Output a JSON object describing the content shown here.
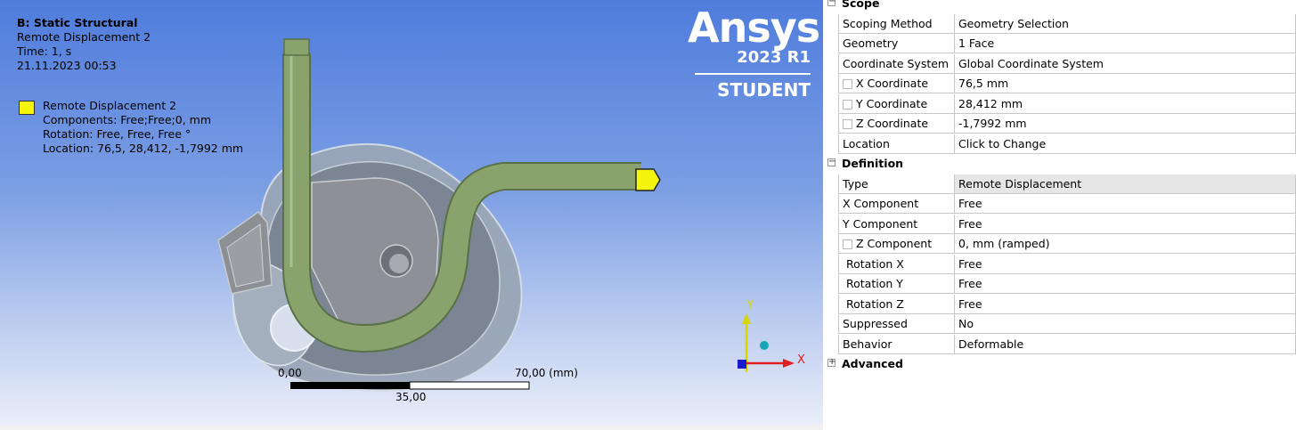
{
  "viewport": {
    "analysis_title": "B: Static Structural",
    "object_name": "Remote Displacement 2",
    "time": "Time: 1, s",
    "date": "21.11.2023 00:53",
    "legend": {
      "color": "#f4f40c",
      "name": "Remote Displacement 2",
      "components": "Components: Free;Free;0, mm",
      "rotation": "Rotation: Free, Free, Free °",
      "location": "Location: 76,5, 28,412, -1,7992 mm"
    },
    "logo": {
      "brand": "Ansys",
      "version": "2023 R1",
      "edition": "STUDENT"
    },
    "scale_bar": {
      "zero": "0,00",
      "mid": "35,00",
      "max": "70,00 (mm)"
    },
    "triad": {
      "y_label": "Y",
      "x_label": "X"
    },
    "colors": {
      "part_green": "#8aa36c",
      "housing_gray": "#8a9099",
      "selection_yellow": "#f4f40c"
    }
  },
  "details": {
    "groups": [
      {
        "label": "Scope",
        "expander": "−",
        "rows": [
          {
            "name": "Scoping Method",
            "value": "Geometry Selection",
            "checkbox": false
          },
          {
            "name": "Geometry",
            "value": "1 Face",
            "checkbox": false
          },
          {
            "name": "Coordinate System",
            "value": "Global Coordinate System",
            "checkbox": false
          },
          {
            "name": "X Coordinate",
            "value": "76,5 mm",
            "checkbox": true
          },
          {
            "name": "Y Coordinate",
            "value": "28,412 mm",
            "checkbox": true
          },
          {
            "name": "Z Coordinate",
            "value": "-1,7992 mm",
            "checkbox": true
          },
          {
            "name": "Location",
            "value": "Click to Change",
            "checkbox": false
          }
        ]
      },
      {
        "label": "Definition",
        "expander": "−",
        "rows": [
          {
            "name": "Type",
            "value": "Remote Displacement",
            "checkbox": false,
            "selected": true
          },
          {
            "name": "X Component",
            "value": "Free",
            "checkbox": false
          },
          {
            "name": "Y Component",
            "value": "Free",
            "checkbox": false
          },
          {
            "name": "Z Component",
            "value": "0, mm  (ramped)",
            "checkbox": true
          },
          {
            "name": "Rotation X",
            "value": "Free",
            "checkbox": false
          },
          {
            "name": "Rotation Y",
            "value": "Free",
            "checkbox": false
          },
          {
            "name": "Rotation Z",
            "value": "Free",
            "checkbox": false
          },
          {
            "name": "Suppressed",
            "value": "No",
            "checkbox": false
          },
          {
            "name": "Behavior",
            "value": "Deformable",
            "checkbox": false
          }
        ]
      },
      {
        "label": "Advanced",
        "expander": "+",
        "rows": []
      }
    ]
  }
}
